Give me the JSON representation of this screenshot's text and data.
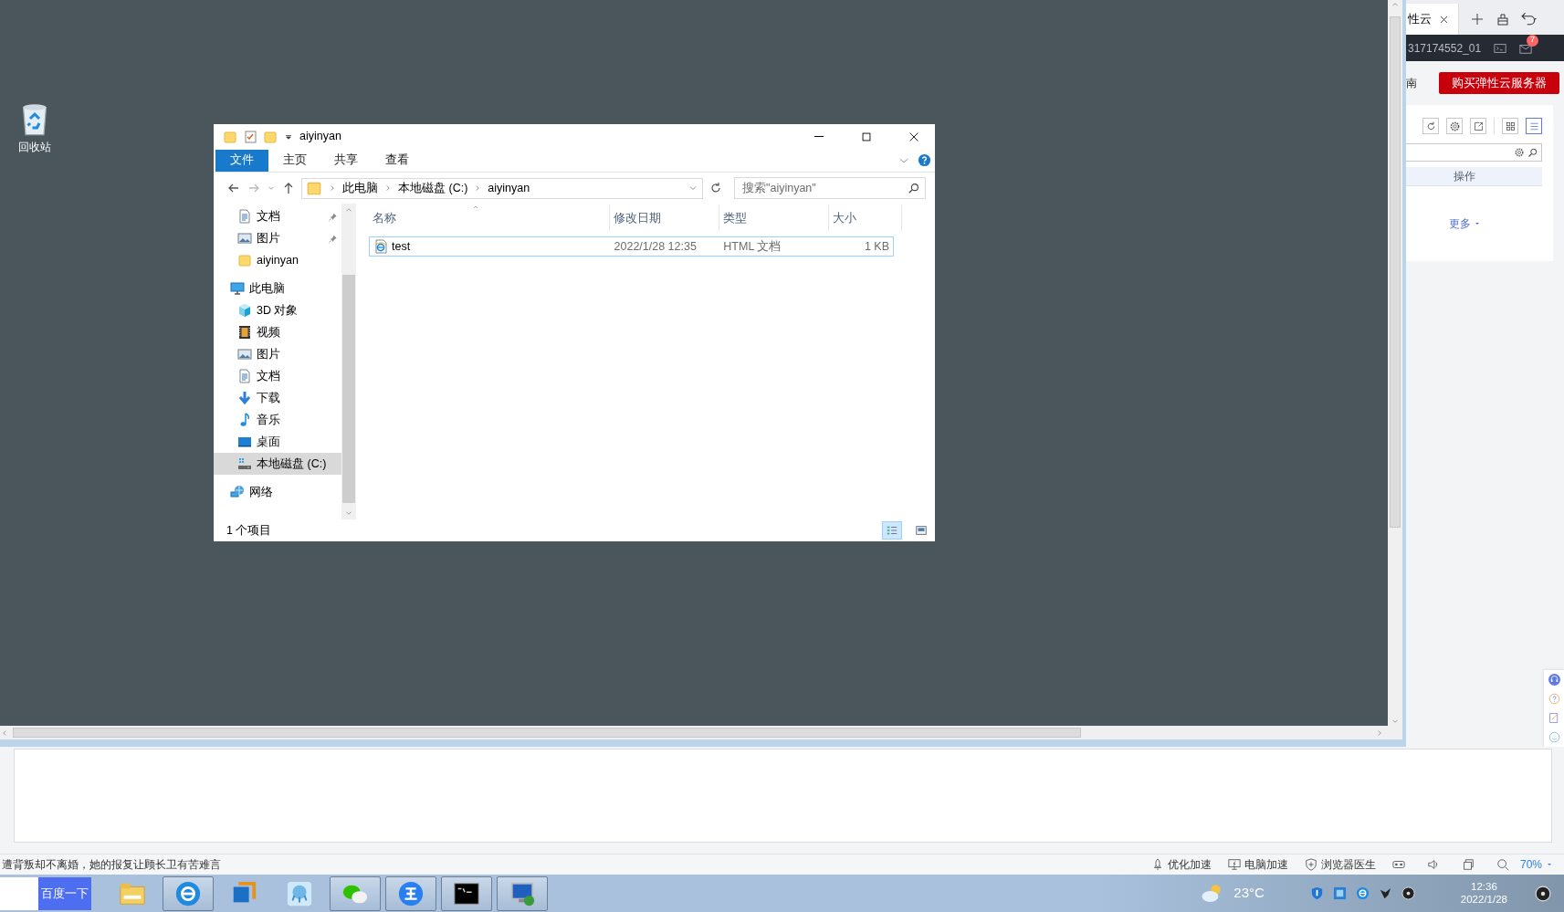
{
  "desktop": {
    "icons": [
      {
        "label": "回收站",
        "kind": "recycle-bin"
      }
    ]
  },
  "explorer": {
    "title": "aiyinyan",
    "ribbon_tabs": [
      {
        "label": "文件",
        "selected": true
      },
      {
        "label": "主页",
        "selected": false
      },
      {
        "label": "共享",
        "selected": false
      },
      {
        "label": "查看",
        "selected": false
      }
    ],
    "breadcrumb": [
      "此电脑",
      "本地磁盘 (C:)",
      "aiyinyan"
    ],
    "search": {
      "placeholder": "搜索\"aiyinyan\""
    },
    "quick_access": [
      {
        "label": "文档",
        "kind": "document",
        "pinned": true
      },
      {
        "label": "图片",
        "kind": "picture",
        "pinned": true
      },
      {
        "label": "aiyinyan",
        "kind": "folder",
        "pinned": false
      }
    ],
    "tree": [
      {
        "label": "此电脑",
        "kind": "pc",
        "selected": false,
        "children": [
          {
            "label": "3D 对象",
            "kind": "cube",
            "selected": false
          },
          {
            "label": "视频",
            "kind": "video",
            "selected": false
          },
          {
            "label": "图片",
            "kind": "picture",
            "selected": false
          },
          {
            "label": "文档",
            "kind": "document",
            "selected": false
          },
          {
            "label": "下载",
            "kind": "download",
            "selected": false
          },
          {
            "label": "音乐",
            "kind": "music",
            "selected": false
          },
          {
            "label": "桌面",
            "kind": "desktop",
            "selected": false
          },
          {
            "label": "本地磁盘 (C:)",
            "kind": "drive",
            "selected": true
          }
        ]
      },
      {
        "label": "网络",
        "kind": "network",
        "selected": false
      }
    ],
    "columns": [
      "名称",
      "修改日期",
      "类型",
      "大小"
    ],
    "rows": [
      {
        "cells": [
          "test",
          "2022/1/28 12:35",
          "HTML 文档",
          "1 KB"
        ],
        "focused": true
      }
    ],
    "status": "1 个项目",
    "view_buttons": [
      {
        "kind": "details",
        "selected": true
      },
      {
        "kind": "large-icons",
        "selected": false
      }
    ]
  },
  "browser": {
    "tab": "性云",
    "account": "317174552_01",
    "mail_badge": "7",
    "guide": "南",
    "buy_button": "购买弹性云服务器",
    "card_tools": [
      {
        "kind": "refresh",
        "selected": false
      },
      {
        "kind": "settings",
        "selected": false
      },
      {
        "kind": "export",
        "selected": false
      },
      {
        "kind": "grid",
        "selected": false
      },
      {
        "kind": "list",
        "selected": true
      }
    ],
    "column": "操作",
    "more_link": "更多"
  },
  "status_bar": {
    "news": "遭背叛却不离婚，她的报复让顾长卫有苦难言",
    "tools": [
      {
        "label": "优化加速",
        "kind": "rocket"
      },
      {
        "label": "电脑加速",
        "kind": "monitor"
      },
      {
        "label": "浏览器医生",
        "kind": "shield"
      }
    ],
    "zoom": "70%"
  },
  "taskbar": {
    "search_button": "百度一下",
    "apps": [
      {
        "kind": "folder",
        "running": false
      },
      {
        "kind": "ie",
        "running": true
      },
      {
        "kind": "cube",
        "running": false
      },
      {
        "kind": "octopus",
        "running": false
      },
      {
        "kind": "wechat",
        "running": true
      },
      {
        "kind": "app-blue",
        "running": true
      },
      {
        "kind": "cmd",
        "running": true
      },
      {
        "kind": "remote",
        "running": true
      }
    ],
    "weather": "23°C",
    "time": "12:36",
    "date": "2022/1/28"
  }
}
